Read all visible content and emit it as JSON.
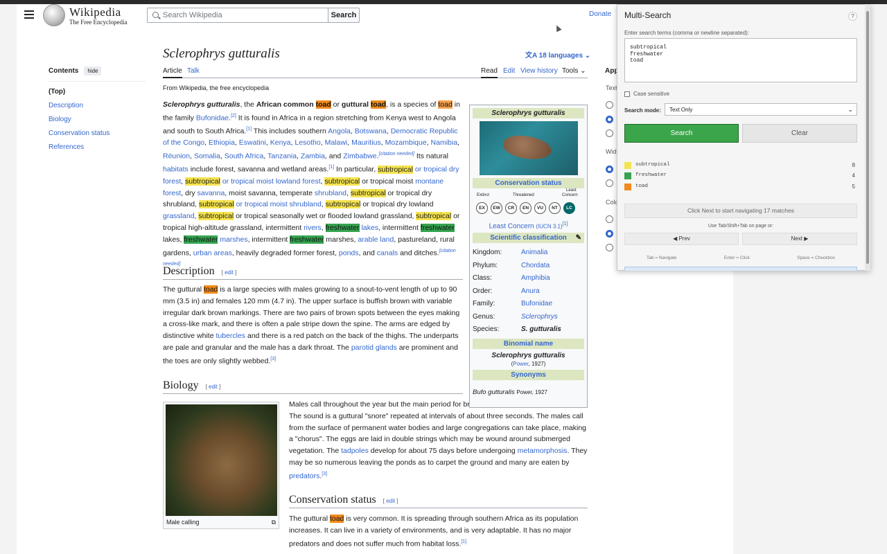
{
  "header": {
    "wordmark": "Wikipedia",
    "tagline": "The Free Encyclopedia",
    "search_placeholder": "Search Wikipedia",
    "search_button": "Search",
    "donate": "Donate"
  },
  "toc": {
    "title": "Contents",
    "hide": "hide",
    "items": [
      "(Top)",
      "Description",
      "Biology",
      "Conservation status",
      "References"
    ]
  },
  "page": {
    "title": "Sclerophrys gutturalis",
    "languages": "18 languages",
    "tabs": [
      "Article",
      "Talk"
    ],
    "actions": [
      "Read",
      "Edit",
      "View history",
      "Tools"
    ],
    "from": "From Wikipedia, the free encyclopedia"
  },
  "sections": {
    "description": "Description",
    "biology": "Biology",
    "conservation": "Conservation status",
    "edit": "edit"
  },
  "infobox": {
    "title": "Sclerophrys gutturalis",
    "conservation_header": "Conservation status",
    "status_labels": {
      "extinct": "Extinct",
      "threatened": "Threatened",
      "least": "Least",
      "concern": "Concern"
    },
    "status_codes": [
      "EX",
      "EW",
      "CR",
      "EN",
      "VU",
      "NT",
      "LC"
    ],
    "status_text": "Least Concern",
    "status_ref": "(IUCN 3.1)",
    "classification_header": "Scientific classification",
    "taxonomy": [
      [
        "Kingdom:",
        "Animalia"
      ],
      [
        "Phylum:",
        "Chordata"
      ],
      [
        "Class:",
        "Amphibia"
      ],
      [
        "Order:",
        "Anura"
      ],
      [
        "Family:",
        "Bufonidae"
      ],
      [
        "Genus:",
        "Sclerophrys"
      ],
      [
        "Species:",
        "S. gutturalis"
      ]
    ],
    "binomial_header": "Binomial name",
    "binomial": "Sclerophrys gutturalis",
    "binomial_author": "Power",
    "binomial_year": ", 1927)",
    "synonyms_header": "Synonyms",
    "synonym": "Bufo gutturalis",
    "synonym_author": "Power, 1927"
  },
  "figure": {
    "caption": "Male calling"
  },
  "appearance": {
    "title": "Appearance",
    "text": "Text",
    "width": "Width",
    "color": "Color"
  },
  "panel": {
    "title": "Multi-Search",
    "help": "?",
    "terms_label": "Enter search terms (comma or newline separated):",
    "terms_value": "subtropical\nfreshwater\ntoad",
    "case_sensitive": "Case sensitive",
    "mode_label": "Search mode:",
    "mode_value": "Text Only",
    "search": "Search",
    "clear": "Clear",
    "terms": [
      {
        "name": "subtropical",
        "count": "8",
        "color": "#f5e34d"
      },
      {
        "name": "freshwater",
        "count": "4",
        "color": "#35a350"
      },
      {
        "name": "toad",
        "count": "5",
        "color": "#f08a1d"
      }
    ],
    "status": "Click Next to start navigating 17 matches",
    "hint": "Use Tab/Shift+Tab on page or:",
    "prev": "◀ Prev",
    "next": "Next ▶",
    "keys": [
      "Tab = Navigate",
      "Enter = Click",
      "Space = Checkbox"
    ]
  }
}
